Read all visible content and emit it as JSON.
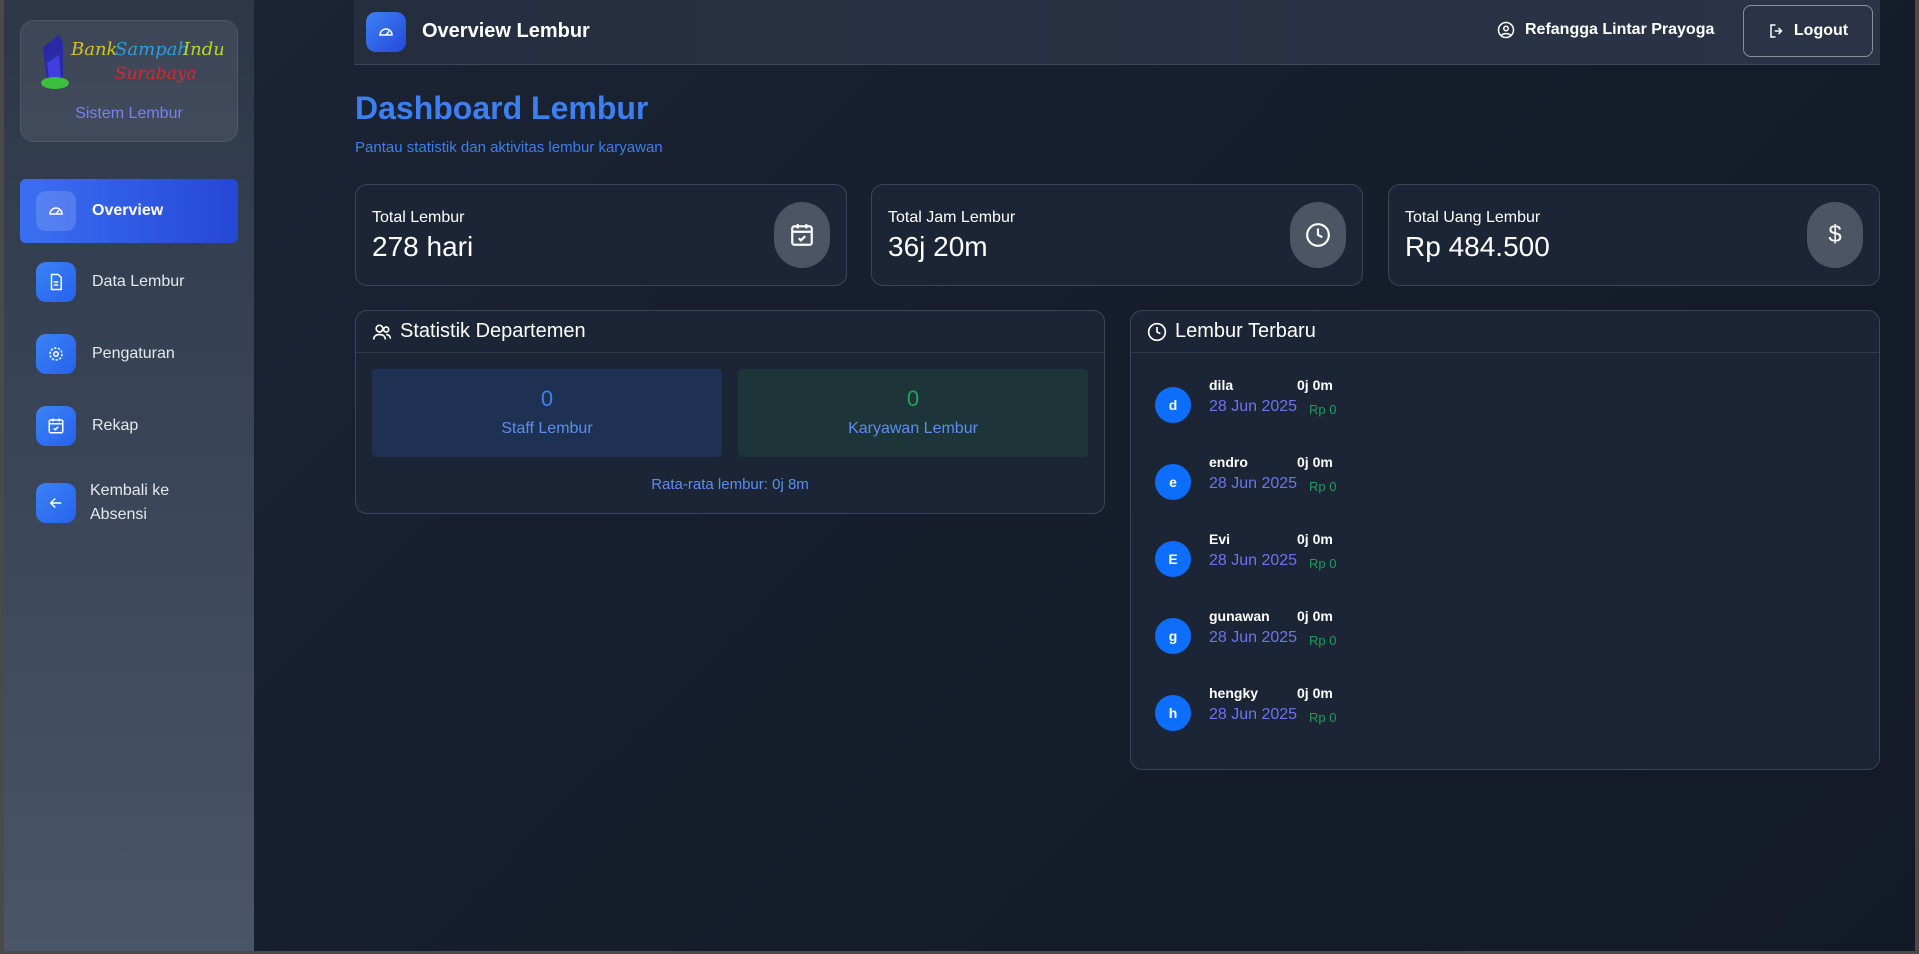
{
  "sidebar": {
    "logo_text_1": "Bank Sampah Induk",
    "logo_text_2": "Surabaya",
    "subtitle": "Sistem Lembur",
    "items": [
      {
        "label": "Overview",
        "icon": "gauge-icon",
        "active": true
      },
      {
        "label": "Data Lembur",
        "icon": "document-icon",
        "active": false
      },
      {
        "label": "Pengaturan",
        "icon": "gear-icon",
        "active": false
      },
      {
        "label": "Rekap",
        "icon": "calendar-check-icon",
        "active": false
      },
      {
        "label": "Kembali ke Absensi",
        "icon": "arrow-left-icon",
        "active": false
      }
    ]
  },
  "header": {
    "title": "Overview Lembur",
    "user_name": "Refangga Lintar Prayoga",
    "logout_label": "Logout"
  },
  "page": {
    "title": "Dashboard Lembur",
    "subtitle": "Pantau statistik dan aktivitas lembur karyawan"
  },
  "stats": [
    {
      "label": "Total Lembur",
      "value": "278 hari",
      "icon": "calendar-check-icon"
    },
    {
      "label": "Total Jam Lembur",
      "value": "36j 20m",
      "icon": "clock-icon"
    },
    {
      "label": "Total Uang Lembur",
      "value": "Rp 484.500",
      "icon": "dollar-icon"
    }
  ],
  "department": {
    "title": "Statistik Departemen",
    "staff_value": "0",
    "staff_label": "Staff Lembur",
    "employee_value": "0",
    "employee_label": "Karyawan Lembur",
    "average": "Rata-rata lembur: 0j 8m"
  },
  "recent": {
    "title": "Lembur Terbaru",
    "items": [
      {
        "initial": "d",
        "name": "dila",
        "hours": "0j 0m",
        "date": "28 Jun 2025",
        "money": "Rp 0"
      },
      {
        "initial": "e",
        "name": "endro",
        "hours": "0j 0m",
        "date": "28 Jun 2025",
        "money": "Rp 0"
      },
      {
        "initial": "E",
        "name": "Evi",
        "hours": "0j 0m",
        "date": "28 Jun 2025",
        "money": "Rp 0"
      },
      {
        "initial": "g",
        "name": "gunawan",
        "hours": "0j 0m",
        "date": "28 Jun 2025",
        "money": "Rp 0"
      },
      {
        "initial": "h",
        "name": "hengky",
        "hours": "0j 0m",
        "date": "28 Jun 2025",
        "money": "Rp 0"
      }
    ]
  },
  "colors": {
    "accent": "#3b7ff0",
    "avatar": "#0d6efd",
    "money": "#1f9d55",
    "date": "#6b74f0"
  }
}
